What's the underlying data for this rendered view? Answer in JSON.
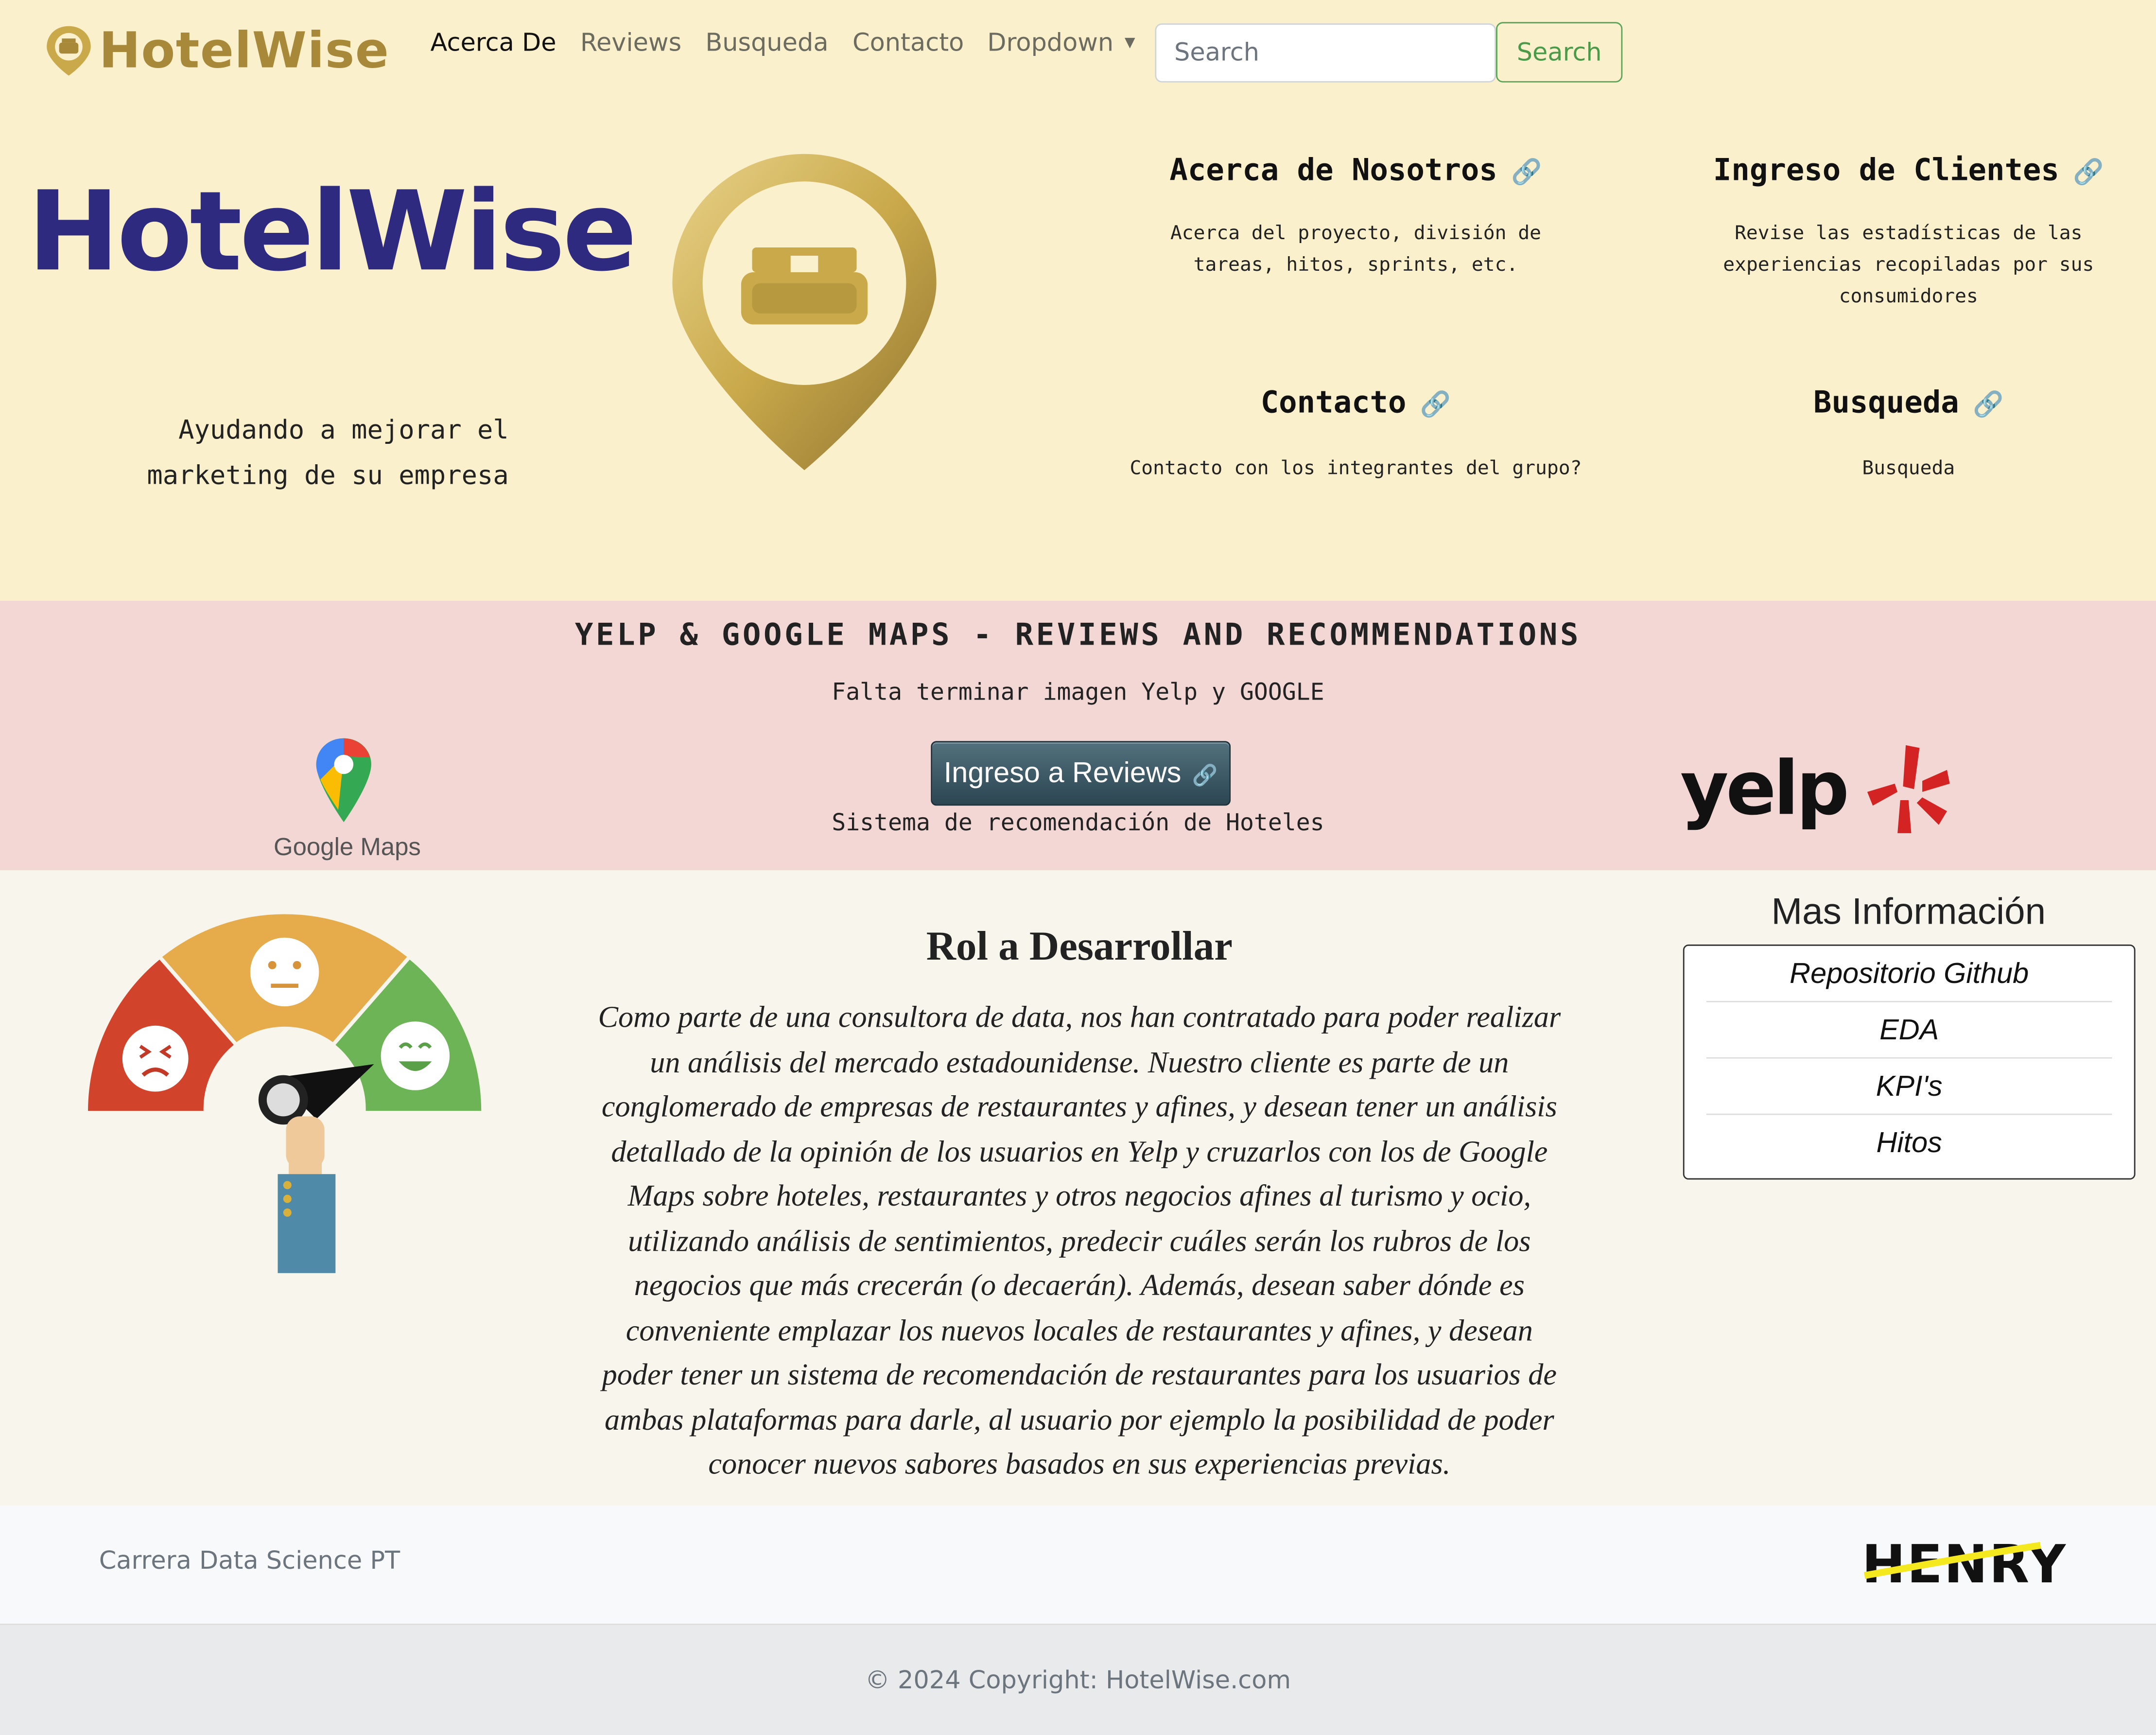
{
  "navbar": {
    "brand_text": "HotelWise",
    "links": [
      {
        "label": "Acerca De",
        "active": true
      },
      {
        "label": "Reviews",
        "active": false
      },
      {
        "label": "Busqueda",
        "active": false
      },
      {
        "label": "Contacto",
        "active": false
      },
      {
        "label": "Dropdown",
        "active": false
      }
    ],
    "search_placeholder": "Search",
    "search_button": "Search"
  },
  "hero": {
    "title": "HotelWise",
    "tagline": "Ayudando a mejorar el marketing de su empresa",
    "cards": [
      {
        "title": "Acerca de Nosotros",
        "text": "Acerca del proyecto, división de tareas, hitos, sprints, etc."
      },
      {
        "title": "Ingreso de Clientes",
        "text": "Revise las estadísticas de las experiencias recopiladas por sus consumidores"
      },
      {
        "title": "Contacto",
        "text": "Contacto con los integrantes del grupo?"
      },
      {
        "title": "Busqueda",
        "text": "Busqueda"
      }
    ]
  },
  "band": {
    "heading": "YELP & GOOGLE MAPS - REVIEWS AND RECOMMENDATIONS",
    "note": "Falta terminar imagen Yelp y GOOGLE",
    "button_label": "Ingreso a Reviews",
    "caption": "Sistema de recomendación de Hoteles",
    "google_label": "Google Maps",
    "yelp_label": "yelp"
  },
  "role": {
    "title": "Rol a Desarrollar",
    "body": "Como parte de una consultora de data, nos han contratado para poder realizar un análisis del mercado estadounidense. Nuestro cliente es parte de un conglomerado de empresas de restaurantes y afines, y desean tener un análisis detallado de la opinión de los usuarios en Yelp y cruzarlos con los de Google Maps sobre hoteles, restaurantes y otros negocios afines al turismo y ocio, utilizando análisis de sentimientos, predecir cuáles serán los rubros de los negocios que más crecerán (o decaerán). Además, desean saber dónde es conveniente emplazar los nuevos locales de restaurantes y afines, y desean poder tener un sistema de recomendación de restaurantes para los usuarios de ambas plataformas para darle, al usuario por ejemplo la posibilidad de poder conocer nuevos sabores basados en sus experiencias previas."
  },
  "more_info": {
    "title": "Mas Información",
    "items": [
      "Repositorio Github",
      "EDA",
      "KPI's",
      "Hitos"
    ]
  },
  "footer": {
    "career": "Carrera Data Science PT",
    "henry_label": "HENRY",
    "copyright": "© 2024 Copyright: HotelWise.com"
  },
  "colors": {
    "hero_bg": "#fbf0cc",
    "band_bg": "#f2d7d4",
    "role_bg": "#f7f5ec",
    "brand_blue": "#2d2a80",
    "gold": "#c9a94a",
    "search_green": "#4a9a4a"
  },
  "icons": {
    "link": "link-icon",
    "caret": "caret-down-icon"
  }
}
